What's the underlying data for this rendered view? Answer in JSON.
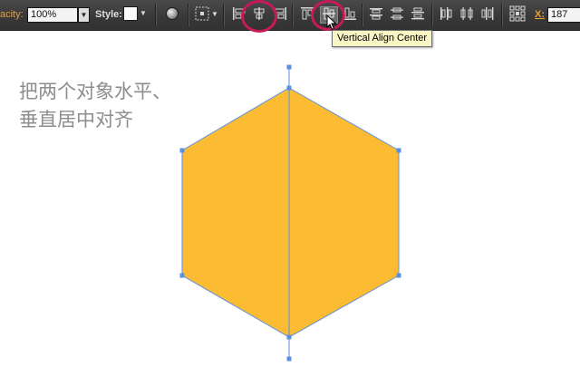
{
  "toolbar": {
    "opacity_label": "acity:",
    "opacity_value": "100%",
    "style_label": "Style:",
    "x_label": "X:",
    "x_value": "187",
    "icons": [
      "globe-icon",
      "transform-grid-icon",
      "align-left-icon",
      "align-horizontal-center-icon",
      "align-right-icon",
      "align-top-icon",
      "align-vertical-center-icon",
      "align-bottom-icon",
      "distribute-top-icon",
      "distribute-vertical-center-icon",
      "distribute-bottom-icon",
      "distribute-left-icon",
      "distribute-horizontal-center-icon",
      "distribute-right-icon",
      "reference-point-icon"
    ],
    "highlight_color": "#c8195a",
    "active_tool": "align-vertical-center"
  },
  "tooltip": {
    "text": "Vertical Align Center"
  },
  "canvas": {
    "caption_line1": "把两个对象水平、",
    "caption_line2": "垂直居中对齐",
    "shape_fill": "#fbbc33",
    "selection_color": "#5b8fe0",
    "shape": "hexagon",
    "guide": "vertical-line"
  }
}
